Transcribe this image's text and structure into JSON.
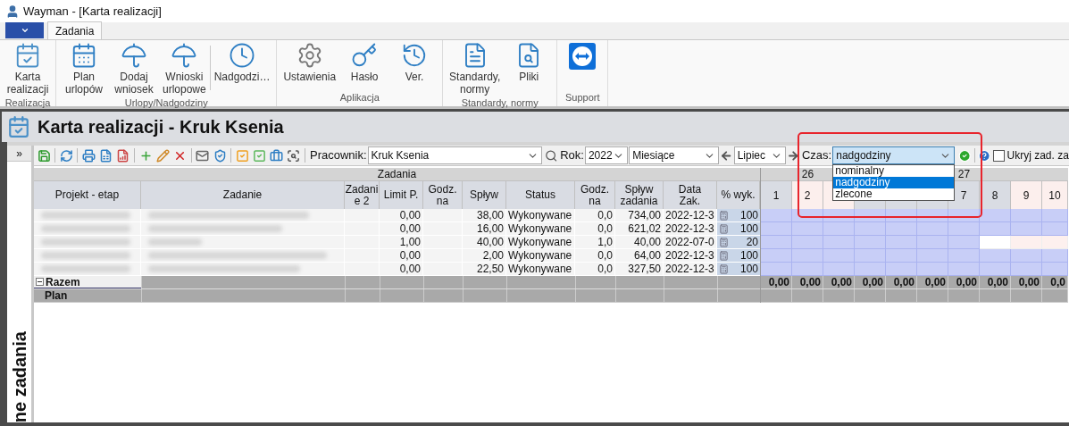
{
  "window": {
    "title": "Wayman - [Karta realizacji]"
  },
  "ribbon": {
    "tabs": [
      {
        "label": "Zadania",
        "selected": true
      }
    ],
    "groups": [
      {
        "label": "Realizacja",
        "buttons": [
          {
            "kind": "large",
            "label": "Karta\nrealizacji"
          }
        ]
      },
      {
        "label": "Urlopy/Nadgodziny",
        "buttons": [
          {
            "kind": "large",
            "label": "Plan\nurlopów"
          },
          {
            "kind": "large",
            "label": "Dodaj\nwniosek"
          },
          {
            "kind": "large",
            "label": "Wnioski\nurlopowe"
          },
          {
            "kind": "large",
            "label": "Nadgodzi…"
          }
        ]
      },
      {
        "label": "Aplikacja",
        "buttons": [
          {
            "kind": "large",
            "label": "Ustawienia"
          },
          {
            "kind": "large",
            "label": "Hasło"
          },
          {
            "kind": "large",
            "label": "Ver."
          }
        ]
      },
      {
        "label": "Standardy, normy",
        "buttons": [
          {
            "kind": "large",
            "label": "Standardy,\nnormy"
          },
          {
            "kind": "large",
            "label": "Pliki"
          }
        ]
      },
      {
        "label": "Support",
        "buttons": [
          {
            "kind": "icon"
          }
        ]
      }
    ]
  },
  "document": {
    "title": "Karta realizacji - Kruk Ksenia"
  },
  "side_panel": {
    "expand": "»",
    "title": "ne zadania"
  },
  "toolbar": {
    "employee_label": "Pracownik:",
    "employee": "Kruk Ksenia",
    "year_label": "Rok:",
    "year": "2022",
    "period": "Miesiące",
    "month": "Lipiec",
    "time_label": "Czas:",
    "time": "nadgodziny",
    "time_options": [
      {
        "label": "nominalny",
        "selected": false
      },
      {
        "label": "nadgodziny",
        "selected": true
      },
      {
        "label": "zlecone",
        "selected": false
      }
    ],
    "hide_label": "Ukryj zad. za",
    "hide_checked": false
  },
  "grid": {
    "group_header": "Zadania",
    "columns": [
      "Projekt - etap",
      "Zadanie",
      "Zadani\ne 2",
      "Limit P.",
      "Godz.\nna",
      "Spływ",
      "Status",
      "Godz.\nna",
      "Spływ\nzadania",
      "Data\nZak.",
      "% wyk."
    ],
    "days": [
      {
        "label": "1",
        "weekend": false
      },
      {
        "label": "2",
        "weekend": true,
        "week": "26"
      },
      {
        "weekend": true
      },
      {
        "weekend": false
      },
      {
        "weekend": false
      },
      {
        "weekend": false
      },
      {
        "label": "7",
        "weekend": false,
        "week": "27"
      },
      {
        "label": "8",
        "weekend": false
      },
      {
        "label": "9",
        "weekend": true
      },
      {
        "label": "10",
        "weekend": true
      }
    ],
    "rows": [
      {
        "limit": "0,00",
        "splyw": "38,00",
        "status": "Wykonywane",
        "godz_na": "0,0",
        "splyw_zadania": "734,00",
        "data_zak": "2022-12-3",
        "wyk": "100",
        "active": [
          true,
          true,
          true,
          true,
          true,
          true,
          true,
          true,
          true,
          true
        ]
      },
      {
        "limit": "0,00",
        "splyw": "16,00",
        "status": "Wykonywane",
        "godz_na": "0,0",
        "splyw_zadania": "621,02",
        "data_zak": "2022-12-3",
        "wyk": "100",
        "active": [
          true,
          true,
          true,
          true,
          true,
          true,
          true,
          true,
          true,
          true
        ]
      },
      {
        "limit": "1,00",
        "splyw": "40,00",
        "status": "Wykonywane",
        "godz_na": "1,0",
        "splyw_zadania": "40,00",
        "data_zak": "2022-07-0",
        "wyk": "20",
        "active": [
          true,
          true,
          true,
          true,
          true,
          true,
          true,
          false,
          false,
          false
        ]
      },
      {
        "limit": "0,00",
        "splyw": "2,00",
        "status": "Wykonywane",
        "godz_na": "0,0",
        "splyw_zadania": "64,00",
        "data_zak": "2022-12-3",
        "wyk": "100",
        "active": [
          true,
          true,
          true,
          true,
          true,
          true,
          true,
          true,
          true,
          true
        ]
      },
      {
        "limit": "0,00",
        "splyw": "22,50",
        "status": "Wykonywane",
        "godz_na": "0,0",
        "splyw_zadania": "327,50",
        "data_zak": "2022-12-3",
        "wyk": "100",
        "active": [
          true,
          true,
          true,
          true,
          true,
          true,
          true,
          true,
          true,
          true
        ]
      }
    ],
    "total": {
      "label": "Razem",
      "expanded": true,
      "days": [
        "0,00",
        "0,00",
        "0,00",
        "0,00",
        "0,00",
        "0,00",
        "0,00",
        "0,00",
        "0,00",
        "0,0"
      ]
    },
    "plan": {
      "label": "Plan"
    }
  }
}
